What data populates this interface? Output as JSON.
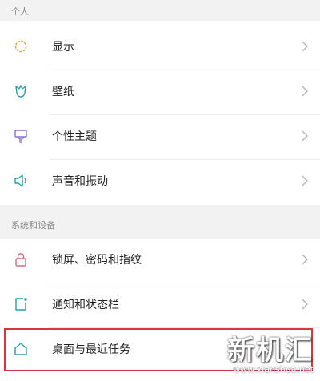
{
  "sections": [
    {
      "label": "个人",
      "items": [
        {
          "label": "显示",
          "icon": "sun-icon"
        },
        {
          "label": "壁纸",
          "icon": "tulip-icon"
        },
        {
          "label": "个性主题",
          "icon": "brush-icon"
        },
        {
          "label": "声音和振动",
          "icon": "speaker-icon"
        }
      ]
    },
    {
      "label": "系统和设备",
      "items": [
        {
          "label": "锁屏、密码和指纹",
          "icon": "lock-icon"
        },
        {
          "label": "通知和状态栏",
          "icon": "notification-icon"
        },
        {
          "label": "桌面与最近任务",
          "icon": "home-icon"
        }
      ]
    }
  ],
  "watermark": {
    "main": "新机汇",
    "sub": "www.xianshua.net"
  },
  "colors": {
    "highlight": "#d9363e",
    "icon_orange": "#e8a33a",
    "icon_teal": "#2f9aa8",
    "icon_purple": "#8a6fc9"
  }
}
